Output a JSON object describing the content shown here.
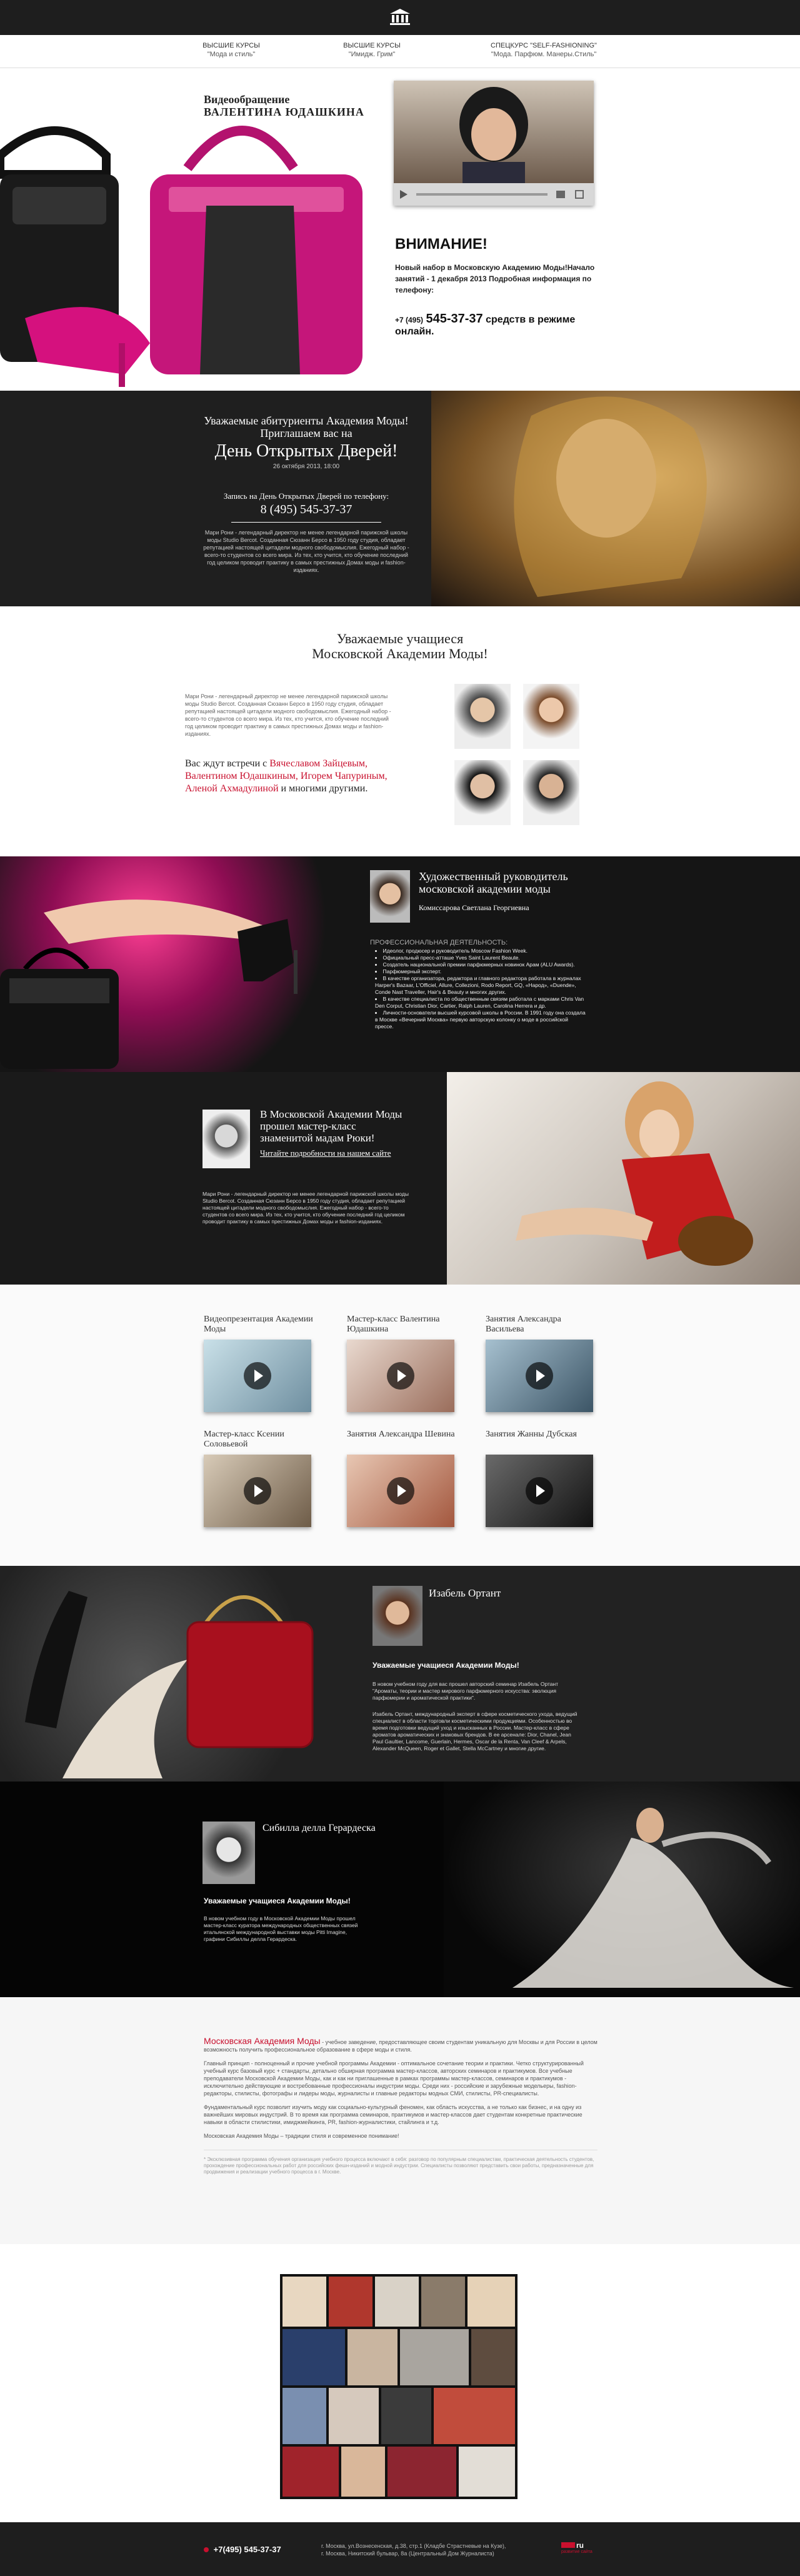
{
  "nav": {
    "items": [
      {
        "title": "Высшие курсы",
        "sub": "\"Мода и стиль\""
      },
      {
        "title": "Высшие курсы",
        "sub": "\"Имидж. Грим\""
      },
      {
        "title": "Спецкурс \"Self-fashioning\"",
        "sub": "\"Мода. Парфюм. Манеры.Стиль\""
      }
    ]
  },
  "hero": {
    "video_title_1": "Видеообращение",
    "video_title_2": "ВАЛЕНТИНА ЮДАШКИНА",
    "attention": "ВНИМАНИЕ!",
    "attention_text": "Новый набор в Московскую Академию Моды!Начало занятий - 1 декабря 2013 Подробная информация по телефону:",
    "phone_prefix": "+7 (495)",
    "phone_number": "545-37-37",
    "phone_suffix": "средств в режиме онлайн."
  },
  "open_day": {
    "line1": "Уважаемые абитуриенты Академия Моды!",
    "line2": "Приглашаем вас на",
    "title": "День Открытых Дверей!",
    "date": "26 октября 2013, 18:00",
    "signup": "Запись на День Открытых Дверей по телефону:",
    "phone": "8 (495) 545-37-37",
    "text": "Мари Рони - легендарный директор не менее легендарной парижской школы моды Studio Berсot. Созданная Сюзанн Берсо в 1950 году студия, обладает репутацией настоящей цитадели модного свободомыслия. Ежегодный набор - всего-то студентов со всего мира. Из тех, кто учится, кто обучение последний год целиком проводит практику в самых престижных Домах моды и fashion-изданиях."
  },
  "students": {
    "title_1": "Уважаемые учащиеся",
    "title_2": "Московской Академии Моды!",
    "text": "Мари Рони - легендарный директор не менее легендарной парижской школы моды Studio Berсot. Созданная Сюзанн Берсо в 1950 году студия, обладает репутацией настоящей цитадели модного свободомыслия. Ежегодный набор - всего-то студентов со всего мира. Из тех, кто учится, кто обучение последний год целиком проводит практику в самых престижных Домах моды и fashion-изданиях.",
    "meet_lead": "Вас ждут встречи с",
    "meet_names": "Вячеславом Зайцевым, Валентином Юдашкиным, Игорем Чапуриным, Аленой Ахмадулиной",
    "meet_tail": "и многими другими."
  },
  "director": {
    "title_1": "Художественный руководитель",
    "title_2": "московской академии моды",
    "name": "Комиссарова Светлана Георгиевна",
    "section": "ПРОФЕССИОНАЛЬНАЯ ДЕЯТЕЛЬНОСТЬ:",
    "bullets": [
      "Идеолог, продюсер и руководитель Moscow Fashion Week.",
      "Официальный пресс-атташе Yves Saint Laurent Beaute.",
      "Создатель национальной премии парфюмерных новинок Арам (ALU Awards).",
      "Парфюмерный эксперт.",
      "В качестве организатора, редактора и главного редактора работала в журналах Harper's Bazaar, L'Officiel, Allure, Collezioni, Rodo Report, GQ, «Народ», «Duende», Conde Nast Traveller, Hair's & Beauty и многих других.",
      "В качестве специалиста по общественным связям работала с марками Chris Van Den Corput, Christian Dior, Cartier, Ralph Lauren, Carolina Herrera и др.",
      "Личноcти-основатели высшей курсовой школы в России. В 1991 году она создала в Москве «Вечерний Москва» первую авторскую колонку о моде в российской прессе."
    ]
  },
  "masterclass": {
    "title": "В Московской Академии Моды прошел мастер-класс знаменитой мадам Рюки!",
    "link": "Читайте подробности на нашем сайте",
    "text": "Мари Рони - легендарный директор не менее легендарной парижской школы моды Studio Berсot. Созданная Сюзанн Берсо в 1950 году студия, обладает репутацией настоящей цитадели модного свободомыслия. Ежегодный набор - всего-то студентов со всего мира. Из тех, кто учится, кто обучение последний год целиком проводит практику в самых престижных Домах моды и fashion-изданиях."
  },
  "videos": [
    {
      "title": "Видеопрезентация Академии Моды"
    },
    {
      "title": "Мастер-класс Валентина Юдашкина"
    },
    {
      "title": "Занятия Александра Васильева"
    },
    {
      "title": "Мастер-класс Ксении Соловьевой"
    },
    {
      "title": "Занятия Александра Шевина"
    },
    {
      "title": "Занятия Жанны Дубская"
    }
  ],
  "izabel": {
    "name": "Изабель Ортант",
    "heading": "Уважаемые учащиеся Академии Моды!",
    "text1": "В новом учебном году для вас прошел авторский семинар Изабель Ортант \"Ароматы, теории и мастер мирового парфюмерного искусства: эволюция парфюмерии и ароматической практики\".",
    "text2": "Изабель Ортант, международный эксперт в сфере косметического ухода, ведущий специалист в области торговли косметическими продукциями. Особенностью во время подготовки ведущий уход и изысканных в России. Мастер-класс в сфере ароматов ароматических и знаковых брендов. В ее арсенале: Dior, Chanel, Jean Paul Gaultier, Lancome, Guerlain, Hermes, Oscar de la Renta, Van Cleef & Arpels, Alexander McQueen, Roger et Gallet, Stella McCartney и многие другие."
  },
  "sibilla": {
    "name": "Сибилла делла Герардеска",
    "heading": "Уважаемые учащиеся Академии Моды!",
    "text": "В новом учебном году в Московской Академии Моды прошел мастер-класс куратора международных общественных связей итальянской международной выставки моды Pitti Imagine, графини Сибиллы делла Герардеска."
  },
  "about": {
    "brand": "Московская Академия Моды",
    "intro": "- учебное заведение, предоставляющее своим студентам уникальную для Москвы и для России в целом возможность получить профессиональное образование в сфере моды и стиля.",
    "p1": "Главный принцип - полноценный и прочие учебной программы Академии - оптимальное сочетание теории и практики. Четко структурированный учебный курс базовый курс + стандарты, детально обширная программа мастер-классов, авторских семинаров и практикумов. Все учебные преподаватели Московской Академии Моды, как и как ни приглашенные в рамках программы мастер-классов, семинаров и практикумов - исключительно действующие и востребованные профессионалы индустрии моды. Среди них - российские и зарубежные модельеры, fashion-редакторы, стилисты, фотографы и лидеры моды, журналисты и главные редакторы модных СМИ, стилисты, PR-специалисты.",
    "p2": "Фундаментальный курс позволит изучить моду как социально-культурный феномен, как область искусства, а не только как бизнес, и на одну из важнейших мировых индустрий. В то время как программа семинаров, практикумов и мастер-классов дает студентам конкретные практические навыки в области стилистики, имиджмейкинга, PR, fashion-журналистики, стайлинга и т.д.",
    "p3": "Московская Академия Моды – традиции стиля и современное понимание!",
    "note": "* Эксклюзивная программа обучения организация учебного процесса включают в себя: разговор по популярным специалистам, практическая деятельность студентов, прохождение профессиональных работ для российских фешн-изданий и модной индустрии. Специалисты позволяют представить свои работы, предназначенные для продвижения и реализации учебного процесса в г. Москве."
  },
  "footer": {
    "phone": "+7(495) 545-37-37",
    "address1": "г. Москва, ул.Вознесенская, д.38, стр.1 (Кладбе Страстневые на Кузе),",
    "address2": "г. Москва, Никитский бульвар, 8а (Центральный Дом Журналиста)",
    "logo_text": "ru",
    "logo_sub": "развитие сайта"
  }
}
